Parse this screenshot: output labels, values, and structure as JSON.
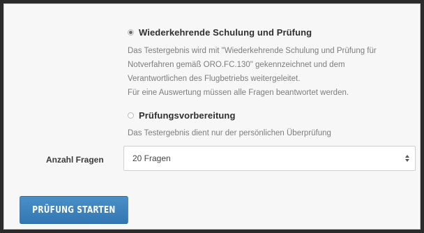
{
  "options": [
    {
      "title": "Wiederkehrende Schulung und Prüfung",
      "selected": true,
      "description_lines": [
        "Das Testergebnis wird mit \"Wiederkehrende Schulung und Prüfung für",
        "Notverfahren gemäß ORO.FC.130\" gekennzeichnet und dem",
        "Verantwortlichen des Flugbetriebs weitergeleitet.",
        "Für eine Auswertung müssen alle Fragen beantwortet werden."
      ]
    },
    {
      "title": "Prüfungsvorbereitung",
      "selected": false,
      "description_lines": [
        "Das Testergebnis dient nur der persönlichen Überprüfung"
      ]
    }
  ],
  "question_count": {
    "label": "Anzahl Fragen",
    "selected_value": "20 Fragen"
  },
  "start_button": {
    "label": "PRÜFUNG STARTEN"
  },
  "colors": {
    "accent": "#3a82bd",
    "panel_bg": "#f7f7f7",
    "frame": "#2b2b2b"
  }
}
